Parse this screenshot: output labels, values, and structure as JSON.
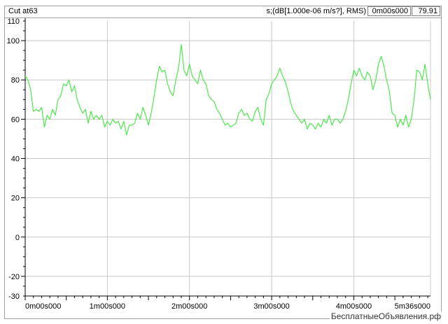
{
  "header": {
    "title": "Cut at63",
    "unit_label": "s;(dB[1.000e-06 m/s?], RMS)",
    "time_readout": "0m00s000",
    "value_readout": "79.91"
  },
  "watermark": "БесплатныеОбъявления.рф",
  "colors": {
    "trace": "#4ce84c",
    "grid": "#c8c8c8",
    "axis": "#000000",
    "frame": "#a0a0a0"
  },
  "chart_data": {
    "type": "line",
    "title": "Cut at63",
    "ylabel": "s;(dB[1.000e-06 m/s?], RMS)",
    "xlabel": "",
    "xlim": [
      0,
      296
    ],
    "ylim": [
      -30,
      110
    ],
    "y_ticks": [
      110,
      100,
      80,
      60,
      40,
      20,
      0,
      -20,
      -30
    ],
    "y_grid": [
      100,
      80,
      60,
      40,
      20,
      0,
      -20
    ],
    "x_ticks": [
      {
        "t": 0,
        "label": "0m00s000"
      },
      {
        "t": 60,
        "label": "1m00s000"
      },
      {
        "t": 120,
        "label": "2m00s000"
      },
      {
        "t": 180,
        "label": "3m00s000"
      },
      {
        "t": 240,
        "label": "4m00s000"
      },
      {
        "t": 296,
        "label": "5m36s000"
      }
    ],
    "x_grid": [
      60,
      120,
      180,
      240,
      296
    ],
    "grid": true,
    "series": [
      {
        "x": [
          0,
          2,
          4,
          6,
          8,
          10,
          12,
          14,
          16,
          18,
          20,
          22,
          24,
          26,
          28,
          30,
          32,
          34,
          36,
          38,
          40,
          42,
          44,
          46,
          48,
          50,
          52,
          54,
          56,
          58,
          60,
          62,
          64,
          66,
          68,
          70,
          72,
          74,
          76,
          78,
          80,
          82,
          84,
          86,
          88,
          90,
          92,
          94,
          96,
          98,
          100,
          102,
          104,
          106,
          108,
          110,
          112,
          114,
          116,
          118,
          120,
          122,
          124,
          126,
          128,
          130,
          132,
          134,
          136,
          138,
          140,
          142,
          144,
          146,
          148,
          150,
          152,
          154,
          156,
          158,
          160,
          162,
          164,
          166,
          168,
          170,
          172,
          174,
          176,
          178,
          180,
          182,
          184,
          186,
          188,
          190,
          192,
          194,
          196,
          198,
          200,
          202,
          204,
          206,
          208,
          210,
          212,
          214,
          216,
          218,
          220,
          222,
          224,
          226,
          228,
          230,
          232,
          234,
          236,
          238,
          240,
          242,
          244,
          246,
          248,
          250,
          252,
          254,
          256,
          258,
          260,
          262,
          264,
          266,
          268,
          270,
          272,
          274,
          276,
          278,
          280,
          282,
          284,
          286,
          288,
          290,
          292,
          294,
          296
        ],
        "values": [
          82,
          80,
          75,
          64,
          65,
          64,
          66,
          56,
          62,
          60,
          65,
          62,
          70,
          72,
          78,
          77,
          80,
          74,
          77,
          70,
          66,
          63,
          65,
          58,
          64,
          60,
          62,
          60,
          62,
          56,
          59,
          57,
          60,
          58,
          59,
          55,
          59,
          52,
          57,
          57,
          58,
          63,
          60,
          66,
          62,
          57,
          63,
          71,
          80,
          87,
          84,
          85,
          78,
          74,
          72,
          80,
          86,
          98,
          85,
          82,
          88,
          82,
          80,
          78,
          85,
          80,
          78,
          72,
          70,
          69,
          65,
          63,
          60,
          57,
          58,
          56,
          57,
          58,
          63,
          65,
          62,
          63,
          60,
          59,
          64,
          66,
          60,
          57,
          70,
          73,
          78,
          80,
          82,
          86,
          82,
          79,
          74,
          68,
          64,
          62,
          60,
          58,
          60,
          55,
          58,
          57,
          55,
          58,
          56,
          60,
          58,
          62,
          57,
          60,
          60,
          58,
          60,
          64,
          70,
          78,
          85,
          82,
          86,
          82,
          80,
          84,
          82,
          75,
          80,
          88,
          92,
          87,
          80,
          74,
          63,
          62,
          56,
          60,
          57,
          62,
          56,
          60,
          70,
          85,
          84,
          80,
          88,
          78,
          70
        ]
      }
    ]
  }
}
